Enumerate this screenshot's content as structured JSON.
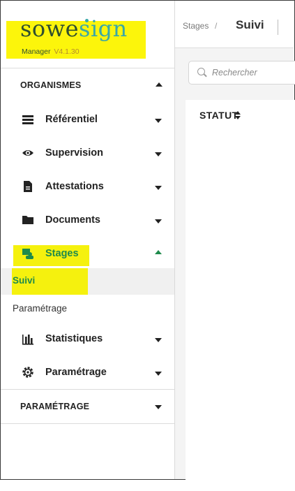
{
  "brand": {
    "logo_part1": "sowe",
    "logo_part2": "sign",
    "subtitle": "Manager",
    "version": "V4.1.30",
    "colors": {
      "dark_green": "#2f4f2f",
      "teal": "#3aa7a7",
      "highlight": "#f5f10e"
    }
  },
  "sidebar": {
    "sections": [
      {
        "label": "ORGANISMES",
        "state": "expanded"
      },
      {
        "label": "PARAMÉTRAGE",
        "state": "collapsed"
      }
    ],
    "items": [
      {
        "label": "Référentiel",
        "icon": "list-icon",
        "state": "collapsed"
      },
      {
        "label": "Supervision",
        "icon": "eye-icon",
        "state": "collapsed"
      },
      {
        "label": "Attestations",
        "icon": "document-icon",
        "state": "collapsed"
      },
      {
        "label": "Documents",
        "icon": "folder-icon",
        "state": "collapsed"
      },
      {
        "label": "Stages",
        "icon": "stages-icon",
        "state": "expanded"
      },
      {
        "label": "Statistiques",
        "icon": "bar-chart-icon",
        "state": "collapsed"
      },
      {
        "label": "Paramétrage",
        "icon": "gear-icon",
        "state": "collapsed"
      }
    ],
    "stages_subitems": [
      {
        "label": "Suivi",
        "active": true
      },
      {
        "label": "Paramétrage",
        "active": false
      }
    ]
  },
  "header": {
    "breadcrumb_root": "Stages",
    "breadcrumb_separator": "/",
    "breadcrumb_current": "Suivi"
  },
  "search": {
    "placeholder": "Rechercher"
  },
  "table": {
    "columns": [
      {
        "label": "STATUT",
        "sortable": true
      }
    ]
  }
}
